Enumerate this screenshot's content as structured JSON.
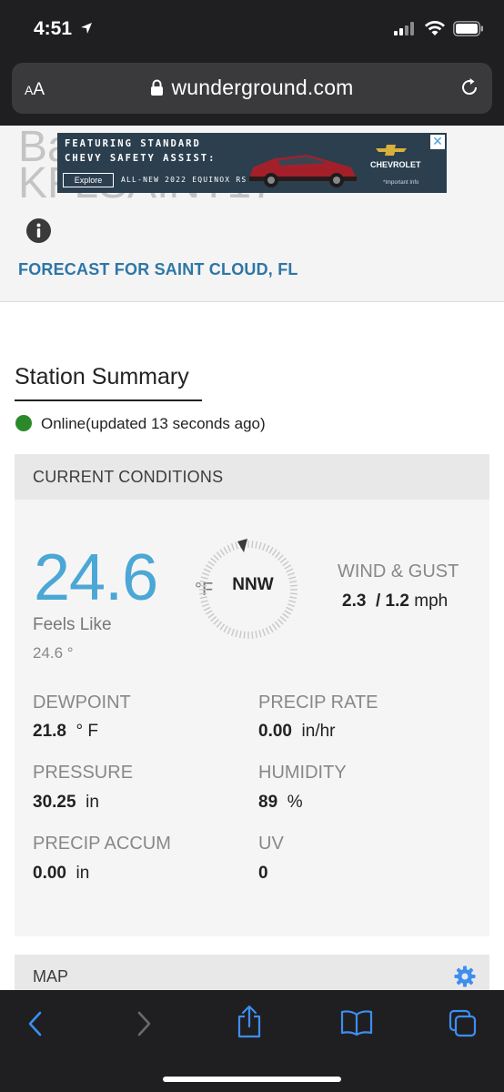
{
  "status_bar": {
    "time": "4:51"
  },
  "browser": {
    "text_size_label_small": "A",
    "text_size_label_big": "A",
    "domain": "wunderground.com"
  },
  "station": {
    "title_partial": "Ba\nKFLSAINT17",
    "forecast_link": "FORECAST FOR SAINT CLOUD, FL"
  },
  "ad": {
    "line1": "FEATURING STANDARD",
    "line2": "CHEVY SAFETY ASSIST:",
    "explore": "Explore",
    "line3": "ALL-NEW 2022 EQUINOX RS",
    "brand": "CHEVROLET",
    "note": "*Important Info",
    "close": "✕"
  },
  "summary": {
    "title": "Station Summary",
    "status": "Online(updated 13 seconds ago)",
    "status_color": "#2a8a2a"
  },
  "conditions": {
    "header": "CURRENT CONDITIONS",
    "temperature": "24.6",
    "temperature_unit": "°F",
    "feels_like_label": "Feels Like",
    "feels_like_value": "24.6 °",
    "wind_direction": "NNW",
    "wind_label": "WIND & GUST",
    "wind_speed": "2.3",
    "wind_gust": "/ 1.2",
    "wind_unit": "mph",
    "dewpoint_label": "DEWPOINT",
    "dewpoint_value": "21.8",
    "dewpoint_unit": "° F",
    "precip_rate_label": "PRECIP RATE",
    "precip_rate_value": "0.00",
    "precip_rate_unit": "in/hr",
    "pressure_label": "PRESSURE",
    "pressure_value": "30.25",
    "pressure_unit": "in",
    "humidity_label": "HUMIDITY",
    "humidity_value": "89",
    "humidity_unit": "%",
    "precip_accum_label": "PRECIP ACCUM",
    "precip_accum_value": "0.00",
    "precip_accum_unit": "in",
    "uv_label": "UV",
    "uv_value": "0"
  },
  "map": {
    "label": "MAP"
  },
  "colors": {
    "accent": "#4ba7d5",
    "link": "#2e76a6",
    "toolbar_icon": "#3d8ef0"
  }
}
